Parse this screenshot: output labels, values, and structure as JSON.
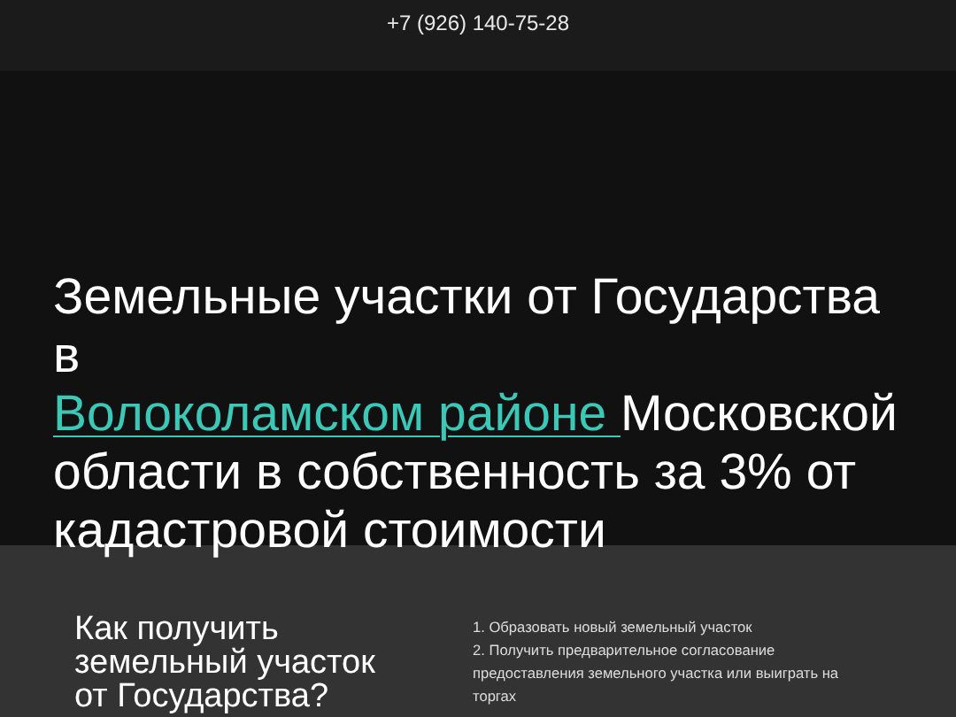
{
  "header": {
    "phone": "+7 (926) 140-75-28"
  },
  "hero": {
    "title_before": "Земельные участки от Государства в ",
    "title_link": "Волоколамском районе ",
    "title_after": "Московской области в собственность за 3% от кадастровой стоимости"
  },
  "how_to": {
    "heading": "Как получить земельный участок от Государства?",
    "steps": [
      "1. Образовать новый земельный участок",
      "2. Получить предварительное согласование предоставления земельного участка или выиграть на торгах"
    ]
  }
}
